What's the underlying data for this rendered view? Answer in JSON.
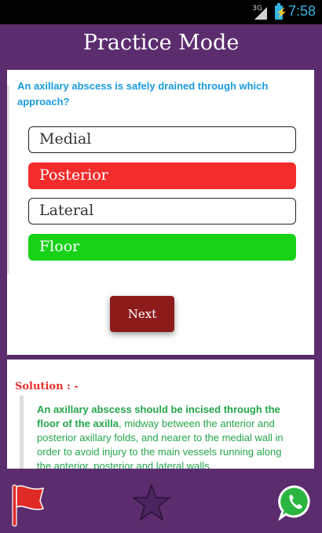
{
  "status_bar": {
    "network": "3G",
    "time": "7:58"
  },
  "header": {
    "title": "Practice Mode"
  },
  "question": {
    "text": "An axillary abscess is safely drained through which approach?"
  },
  "options": [
    {
      "label": "Medial",
      "state": "default"
    },
    {
      "label": "Posterior",
      "state": "incorrect"
    },
    {
      "label": "Lateral",
      "state": "default"
    },
    {
      "label": "Floor",
      "state": "correct"
    }
  ],
  "next_label": "Next",
  "solution": {
    "heading": "Solution : -",
    "bold_part": "An axillary abscess should be incised through the floor of the axilla",
    "rest": ", midway between the anterior and posterior axillary folds, and nearer to the medial wall in order to avoid injury to the main vessels running along the anterior, posterior and lateral walls."
  },
  "bottom_bar": {
    "icons": [
      "flag-icon",
      "star-icon",
      "whatsapp-icon"
    ]
  },
  "colors": {
    "app_purple": "#5b2d6e",
    "question_blue": "#1a9be0",
    "incorrect_red": "#f42c2c",
    "correct_green": "#18d218",
    "next_button": "#8e1b1b",
    "solution_heading": "#e8312e",
    "solution_text": "#23a64b"
  }
}
